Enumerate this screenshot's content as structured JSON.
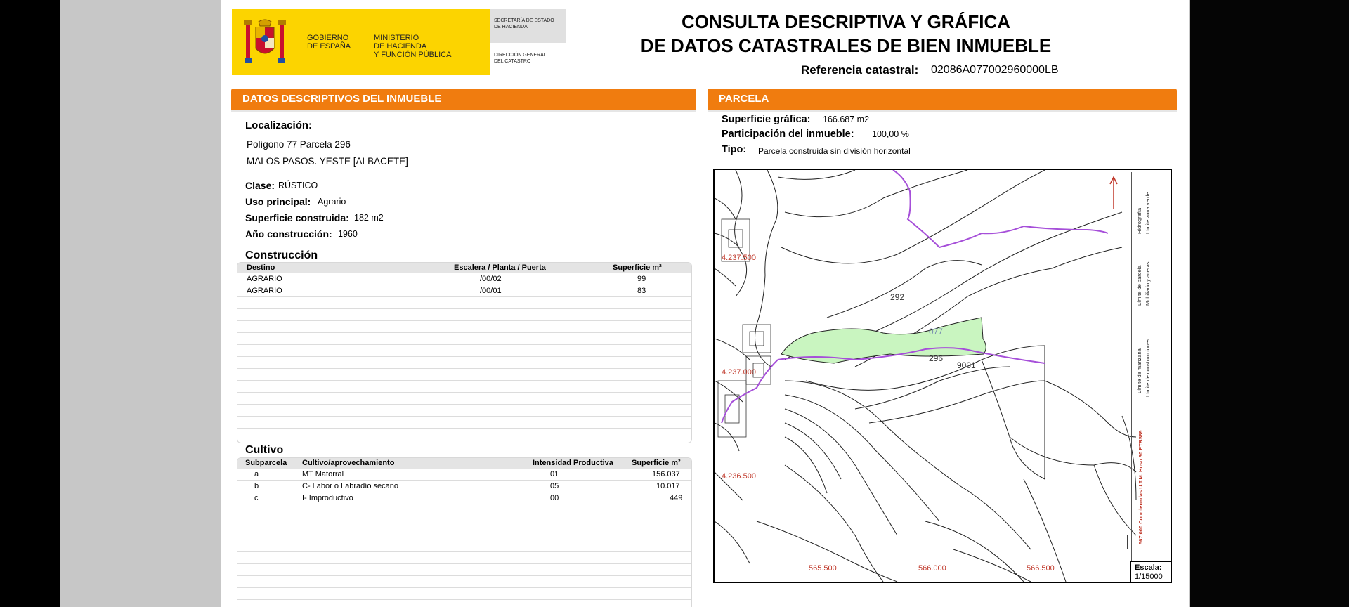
{
  "header": {
    "gobierno": [
      "GOBIERNO",
      "DE ESPAÑA"
    ],
    "ministerio": [
      "MINISTERIO",
      "DE HACIENDA",
      "Y FUNCIÓN PÚBLICA"
    ],
    "secretaria": [
      "SECRETARÍA DE ESTADO",
      "DE HACIENDA"
    ],
    "direccion": [
      "DIRECCIÓN GENERAL",
      "DEL CATASTRO"
    ],
    "title_line1": "CONSULTA DESCRIPTIVA Y GRÁFICA",
    "title_line2": "DE DATOS CATASTRALES DE BIEN INMUEBLE",
    "ref_label": "Referencia catastral:",
    "ref_value": "02086A077002960000LB"
  },
  "left": {
    "section_title": "DATOS DESCRIPTIVOS DEL INMUEBLE",
    "localizacion_label": "Localización:",
    "localizacion_line1": "Polígono 77 Parcela 296",
    "localizacion_line2": "MALOS PASOS. YESTE [ALBACETE]",
    "clase_label": "Clase:",
    "clase_value": "RÚSTICO",
    "uso_label": "Uso principal:",
    "uso_value": "Agrario",
    "superficie_label": "Superficie construida:",
    "superficie_value": "182 m2",
    "anio_label": "Año construcción:",
    "anio_value": "1960",
    "construccion": {
      "title": "Construcción",
      "headers": [
        "Destino",
        "Escalera / Planta / Puerta",
        "Superficie m²"
      ],
      "rows": [
        [
          "AGRARIO",
          "/00/02",
          "99"
        ],
        [
          "AGRARIO",
          "/00/01",
          "83"
        ]
      ]
    },
    "cultivo": {
      "title": "Cultivo",
      "headers": [
        "Subparcela",
        "Cultivo/aprovechamiento",
        "Intensidad Productiva",
        "Superficie m²"
      ],
      "rows": [
        [
          "a",
          "MT Matorral",
          "01",
          "156.037"
        ],
        [
          "b",
          "C- Labor o Labradío secano",
          "05",
          "10.017"
        ],
        [
          "c",
          "I- Improductivo",
          "00",
          "449"
        ]
      ]
    }
  },
  "right": {
    "section_title": "PARCELA",
    "sup_grafica_label": "Superficie gráfica:",
    "sup_grafica_value": "166.687 m2",
    "participacion_label": "Participación del inmueble:",
    "participacion_value": "100,00 %",
    "tipo_label": "Tipo:",
    "tipo_value": "Parcela construida sin división horizontal"
  },
  "map": {
    "labels": {
      "n1": "4.237.500",
      "n2": "4.237.000",
      "n3": "4.236.500",
      "e1": "565.500",
      "e2": "566.000",
      "e3": "566.500",
      "p292": "292",
      "p077": "077",
      "p296": "296",
      "p9001": "9001"
    },
    "legend": [
      "Límite de manzana",
      "Límite de parcela",
      "Hidrografía",
      "Límite de construcciones",
      "Mobiliario y aceras",
      "Límite zona verde"
    ],
    "coords_text": "567,000 Coordenadas U.T.M. Huso 30 ETRS89",
    "scale_label": "Escala:",
    "scale_value": "1/15000",
    "colors": {
      "parcel_fill": "#c9f5c0",
      "river": "#a64fd9",
      "coords": "#c0392b"
    }
  }
}
